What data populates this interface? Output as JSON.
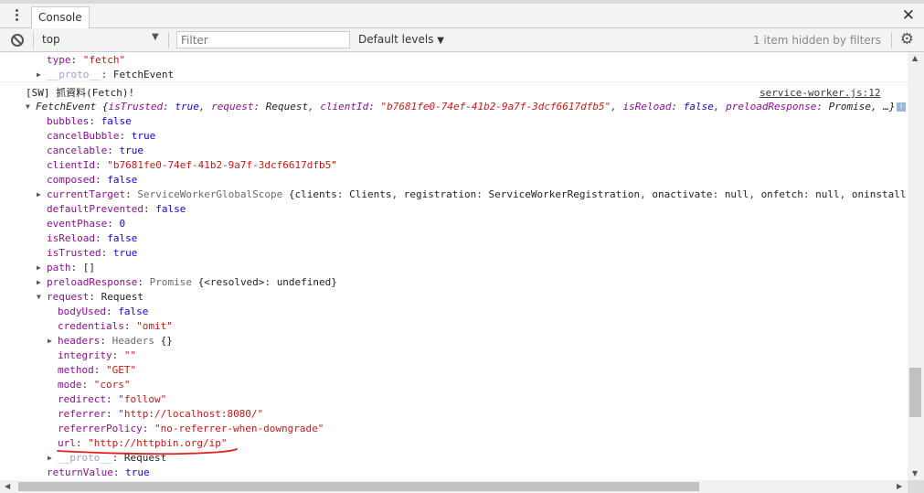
{
  "background_window": {
    "title": "..."
  },
  "tabbar": {
    "tab_label": "Console"
  },
  "toolbar": {
    "context": "top",
    "filter_placeholder": "Filter",
    "levels": "Default levels",
    "hidden_info": "1 item hidden by filters"
  },
  "console": {
    "pre_lines": {
      "type": {
        "key": "type",
        "value": "\"fetch\""
      },
      "proto": {
        "key": "__proto__",
        "value": "FetchEvent"
      }
    },
    "message": {
      "text": "[SW] 抓資料(Fetch)!",
      "source": "service-worker.js:12"
    },
    "summary": {
      "type": "FetchEvent",
      "open": " {",
      "k1": "isTrusted",
      "v1": "true",
      "k2": "request",
      "v2": "Request",
      "k3": "clientId",
      "v3": "\"b7681fe0-74ef-41b2-9a7f-3dcf6617dfb5\"",
      "k4": "isReload",
      "v4": "false",
      "k5": "preloadResponse",
      "v5": "Promise",
      "close": ", …}"
    },
    "props": {
      "bubbles": {
        "key": "bubbles",
        "value": "false"
      },
      "cancelBubble": {
        "key": "cancelBubble",
        "value": "true"
      },
      "cancelable": {
        "key": "cancelable",
        "value": "true"
      },
      "clientId": {
        "key": "clientId",
        "value": "\"b7681fe0-74ef-41b2-9a7f-3dcf6617dfb5\""
      },
      "composed": {
        "key": "composed",
        "value": "false"
      },
      "currentTarget": {
        "key": "currentTarget",
        "type": "ServiceWorkerGlobalScope",
        "open": " {",
        "k1": "clients",
        "v1": "Clients",
        "k2": "registration",
        "v2": "ServiceWorkerRegistration",
        "k3": "onactivate",
        "v3": "null",
        "k4": "onfetch",
        "v4": "null",
        "k5": "oninstall:"
      },
      "defaultPrevented": {
        "key": "defaultPrevented",
        "value": "false"
      },
      "eventPhase": {
        "key": "eventPhase",
        "value": "0"
      },
      "isReload": {
        "key": "isReload",
        "value": "false"
      },
      "isTrusted": {
        "key": "isTrusted",
        "value": "true"
      },
      "path": {
        "key": "path",
        "value": "[]"
      },
      "preloadResponse": {
        "key": "preloadResponse",
        "type": "Promise",
        "open": " {",
        "k1": "<resolved>",
        "v1": "undefined",
        "close": "}"
      },
      "request": {
        "key": "request",
        "value": "Request"
      },
      "returnValue": {
        "key": "returnValue",
        "value": "true"
      }
    },
    "request_props": {
      "bodyUsed": {
        "key": "bodyUsed",
        "value": "false"
      },
      "credentials": {
        "key": "credentials",
        "value": "\"omit\""
      },
      "headers": {
        "key": "headers",
        "type": "Headers",
        "value": " {}"
      },
      "integrity": {
        "key": "integrity",
        "value": "\"\""
      },
      "method": {
        "key": "method",
        "value": "\"GET\""
      },
      "mode": {
        "key": "mode",
        "value": "\"cors\""
      },
      "redirect": {
        "key": "redirect",
        "value": "\"follow\""
      },
      "referrer": {
        "key": "referrer",
        "value": "\"http://localhost:8080/\""
      },
      "referrerPolicy": {
        "key": "referrerPolicy",
        "value": "\"no-referrer-when-downgrade\""
      },
      "url": {
        "key": "url",
        "value": "\"http://httpbin.org/ip\""
      },
      "proto": {
        "key": "__proto__",
        "value": "Request"
      }
    }
  },
  "colors": {
    "annotation": "#e0201c",
    "accent": "#1a1aa6"
  }
}
